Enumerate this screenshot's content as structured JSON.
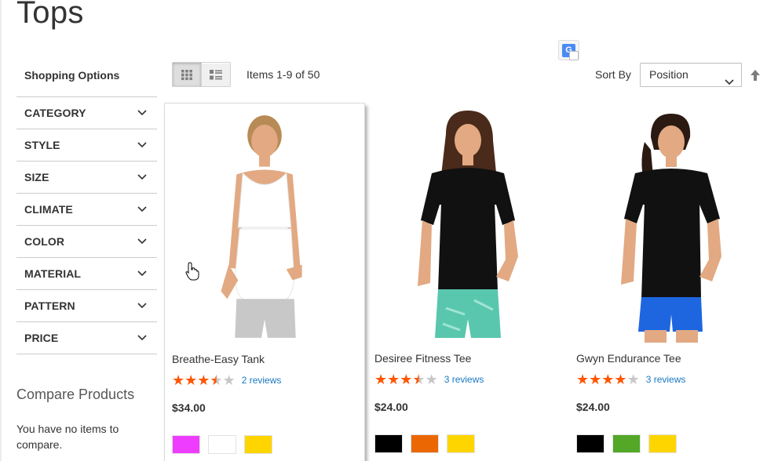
{
  "page": {
    "title": "Tops"
  },
  "sidebar": {
    "heading": "Shopping Options",
    "filters": [
      {
        "label": "CATEGORY"
      },
      {
        "label": "STYLE"
      },
      {
        "label": "SIZE"
      },
      {
        "label": "CLIMATE"
      },
      {
        "label": "COLOR"
      },
      {
        "label": "MATERIAL"
      },
      {
        "label": "PATTERN"
      },
      {
        "label": "PRICE"
      }
    ]
  },
  "compare": {
    "title": "Compare Products",
    "empty_text": "You have no items to compare."
  },
  "toolbar": {
    "items_count": "Items 1-9 of 50",
    "sort_label": "Sort By",
    "sort_value": "Position",
    "view_modes": [
      "grid",
      "list"
    ],
    "active_mode": "grid"
  },
  "products": [
    {
      "name": "Breathe-Easy Tank",
      "rating": 3.5,
      "reviews": "2 reviews",
      "price": "$34.00",
      "swatches": [
        "#ef3dff",
        "#ffffff",
        "#ffd500"
      ],
      "top_color": "#ffffff",
      "bottom_color": "#c8c8c8",
      "hair_color": "#b88a55"
    },
    {
      "name": "Desiree Fitness Tee",
      "rating": 3.5,
      "reviews": "3 reviews",
      "price": "$24.00",
      "swatches": [
        "#000000",
        "#eb6703",
        "#ffd500"
      ],
      "top_color": "#111111",
      "bottom_color": "#59c7ae",
      "hair_color": "#4a2a1a"
    },
    {
      "name": "Gwyn Endurance Tee",
      "rating": 4,
      "reviews": "3 reviews",
      "price": "$24.00",
      "swatches": [
        "#000000",
        "#53a828",
        "#ffd500"
      ],
      "top_color": "#111111",
      "bottom_color": "#1e66e0",
      "hair_color": "#2a1a12"
    }
  ],
  "colors": {
    "star_on": "#ff5501",
    "star_off": "#c7c7c7",
    "link": "#1979c3",
    "skin": "#e2a982"
  },
  "icons": [
    "chevron-down-icon",
    "grid-icon",
    "list-icon",
    "google-translate-icon",
    "sort-arrow-up-icon",
    "hand-pointer-icon",
    "star-icon"
  ]
}
